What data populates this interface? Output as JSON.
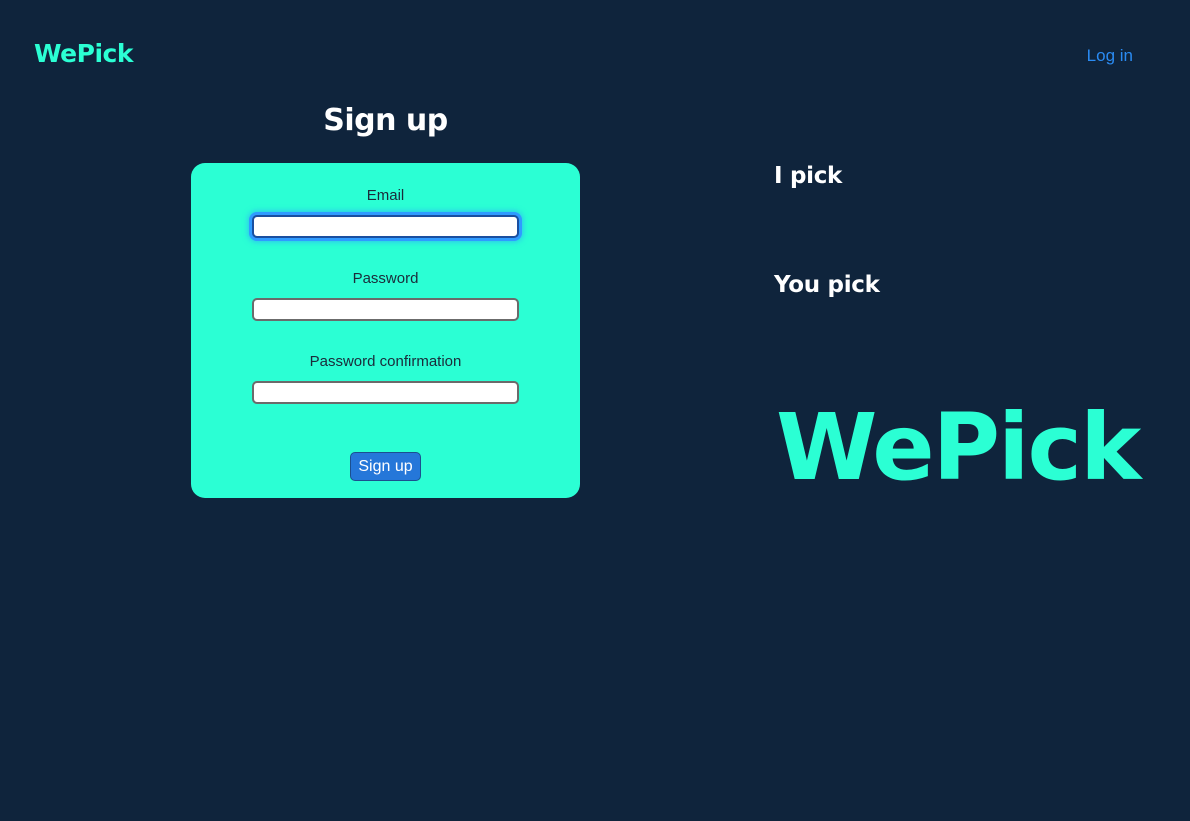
{
  "header": {
    "logo_text": "WePick",
    "login_label": "Log in"
  },
  "signup": {
    "title": "Sign up",
    "fields": [
      {
        "label": "Email",
        "value": ""
      },
      {
        "label": "Password",
        "value": ""
      },
      {
        "label": "Password confirmation",
        "value": ""
      }
    ],
    "submit_label": "Sign up"
  },
  "aside": {
    "tagline_1": "I pick",
    "tagline_2": "You pick",
    "logo_text": "WePick"
  },
  "colors": {
    "background": "#0f243c",
    "accent": "#2bffd4",
    "link": "#2a8bf2",
    "button": "#2577d9"
  }
}
